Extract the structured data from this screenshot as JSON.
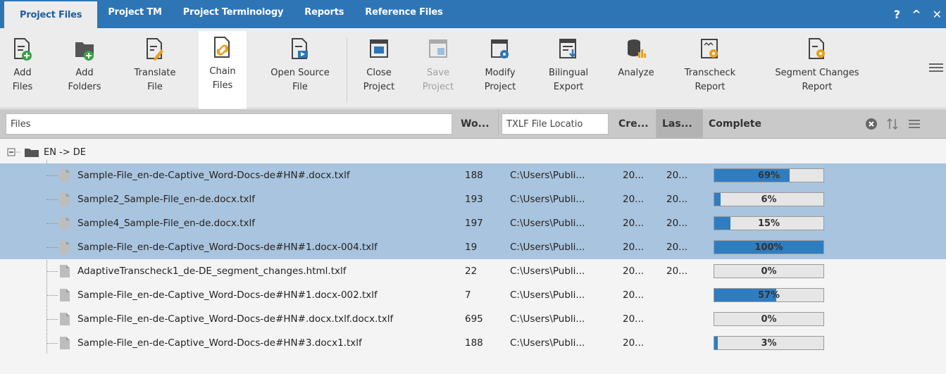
{
  "tabs": [
    {
      "label": "Project Files",
      "active": true
    },
    {
      "label": "Project TM"
    },
    {
      "label": "Project Terminology"
    },
    {
      "label": "Reports"
    },
    {
      "label": "Reference Files"
    }
  ],
  "window_controls": {
    "help": "?",
    "collapse": "^",
    "close": "✕"
  },
  "ribbon": [
    {
      "line1": "Add",
      "line2": "Files",
      "icon": "add-file-icon"
    },
    {
      "line1": "Add",
      "line2": "Folders",
      "icon": "add-folder-icon"
    },
    {
      "line1": "Translate",
      "line2": "File",
      "icon": "translate-file-icon"
    },
    {
      "line1": "Chain",
      "line2": "Files",
      "icon": "chain-files-icon",
      "active": true
    },
    {
      "line1": "Open Source",
      "line2": "File",
      "icon": "open-source-file-icon"
    },
    {
      "line1": "Close",
      "line2": "Project",
      "icon": "close-project-icon"
    },
    {
      "line1": "Save",
      "line2": "Project",
      "icon": "save-project-icon",
      "disabled": true
    },
    {
      "line1": "Modify",
      "line2": "Project",
      "icon": "modify-project-icon"
    },
    {
      "line1": "Bilingual",
      "line2": "Export",
      "icon": "bilingual-export-icon"
    },
    {
      "line1": "Analyze",
      "line2": "",
      "icon": "analyze-icon"
    },
    {
      "line1": "Transcheck",
      "line2": "Report",
      "icon": "transcheck-report-icon"
    },
    {
      "line1": "Segment Changes",
      "line2": "Report",
      "icon": "segment-changes-report-icon"
    }
  ],
  "header": {
    "files_filter": "Files",
    "words": "Wo...",
    "location_filter": "TXLF File Locatio",
    "created": "Cre...",
    "last": "Las...",
    "complete": "Complete"
  },
  "group": {
    "label": "EN -> DE"
  },
  "rows": [
    {
      "name": "Sample-File_en-de-Captive_Word-Docs-de#HN#.docx.txlf",
      "words": "188",
      "location": "C:\\Users\\Publi...",
      "created": "20...",
      "last": "20...",
      "progress": 69,
      "progress_label": "69%",
      "selected": true
    },
    {
      "name": "Sample2_Sample-File_en-de.docx.txlf",
      "words": "193",
      "location": "C:\\Users\\Publi...",
      "created": "20...",
      "last": "20...",
      "progress": 6,
      "progress_label": "6%",
      "selected": true
    },
    {
      "name": "Sample4_Sample-File_en-de.docx.txlf",
      "words": "197",
      "location": "C:\\Users\\Publi...",
      "created": "20...",
      "last": "20...",
      "progress": 15,
      "progress_label": "15%",
      "selected": true
    },
    {
      "name": "Sample-File_en-de-Captive_Word-Docs-de#HN#1.docx-004.txlf",
      "words": "19",
      "location": "C:\\Users\\Publi...",
      "created": "20...",
      "last": "20...",
      "progress": 100,
      "progress_label": "100%",
      "selected": true
    },
    {
      "name": "AdaptiveTranscheck1_de-DE_segment_changes.html.txlf",
      "words": "22",
      "location": "C:\\Users\\Publi...",
      "created": "20...",
      "last": "20...",
      "progress": 0,
      "progress_label": "0%"
    },
    {
      "name": "Sample-File_en-de-Captive_Word-Docs-de#HN#1.docx-002.txlf",
      "words": "7",
      "location": "C:\\Users\\Publi...",
      "created": "20...",
      "last": "",
      "progress": 57,
      "progress_label": "57%"
    },
    {
      "name": "Sample-File_en-de-Captive_Word-Docs-de#HN#.docx.txlf.docx.txlf",
      "words": "695",
      "location": "C:\\Users\\Publi...",
      "created": "20...",
      "last": "",
      "progress": 0,
      "progress_label": "0%"
    },
    {
      "name": "Sample-File_en-de-Captive_Word-Docs-de#HN#3.docx1.txlf",
      "words": "188",
      "location": "C:\\Users\\Publi...",
      "created": "20...",
      "last": "",
      "progress": 3,
      "progress_label": "3%"
    }
  ],
  "colors": {
    "tabbar": "#2e75b6",
    "selected_row": "#a9c4de",
    "progress_fill": "#2f7dc1",
    "header": "#c9c9c9"
  }
}
